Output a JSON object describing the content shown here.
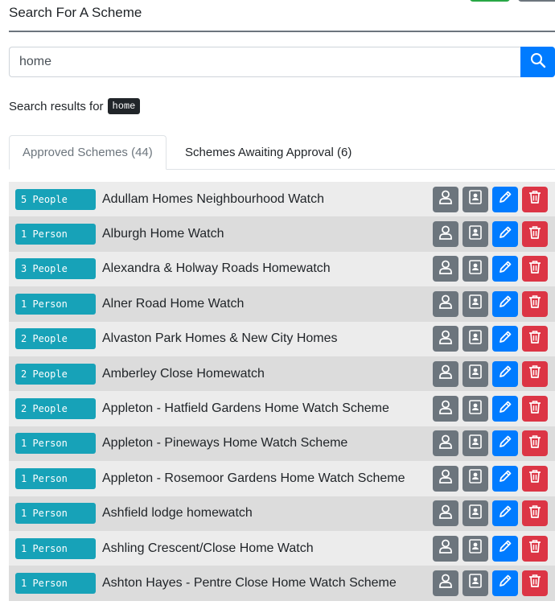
{
  "header": {
    "title": "Search For A Scheme"
  },
  "search": {
    "value": "home"
  },
  "results": {
    "label": "Search results for",
    "term": "home"
  },
  "tabs": [
    {
      "label": "Approved Schemes (44)"
    },
    {
      "label": "Schemes Awaiting Approval (6)"
    }
  ],
  "icons": {
    "search": "search-icon",
    "person": "person-icon",
    "contact": "contact-card-icon",
    "edit": "pencil-icon",
    "delete": "trash-icon"
  },
  "colors": {
    "badge": "#17a2b8",
    "primary": "#007bff",
    "danger": "#dc3545",
    "secondary": "#6c757d"
  },
  "schemes": [
    {
      "count": "5 People",
      "name": "Adullam Homes Neighbourhood Watch"
    },
    {
      "count": "1 Person",
      "name": "Alburgh Home Watch"
    },
    {
      "count": "3 People",
      "name": "Alexandra & Holway Roads Homewatch"
    },
    {
      "count": "1 Person",
      "name": "Alner Road Home Watch"
    },
    {
      "count": "2 People",
      "name": "Alvaston Park Homes & New City Homes"
    },
    {
      "count": "2 People",
      "name": "Amberley Close Homewatch"
    },
    {
      "count": "2 People",
      "name": "Appleton - Hatfield Gardens Home Watch Scheme"
    },
    {
      "count": "1 Person",
      "name": "Appleton - Pineways Home Watch Scheme"
    },
    {
      "count": "1 Person",
      "name": "Appleton - Rosemoor Gardens Home Watch Scheme"
    },
    {
      "count": "1 Person",
      "name": "Ashfield lodge homewatch"
    },
    {
      "count": "1 Person",
      "name": "Ashling Crescent/Close Home Watch"
    },
    {
      "count": "1 Person",
      "name": "Ashton Hayes - Pentre Close Home Watch Scheme"
    }
  ]
}
